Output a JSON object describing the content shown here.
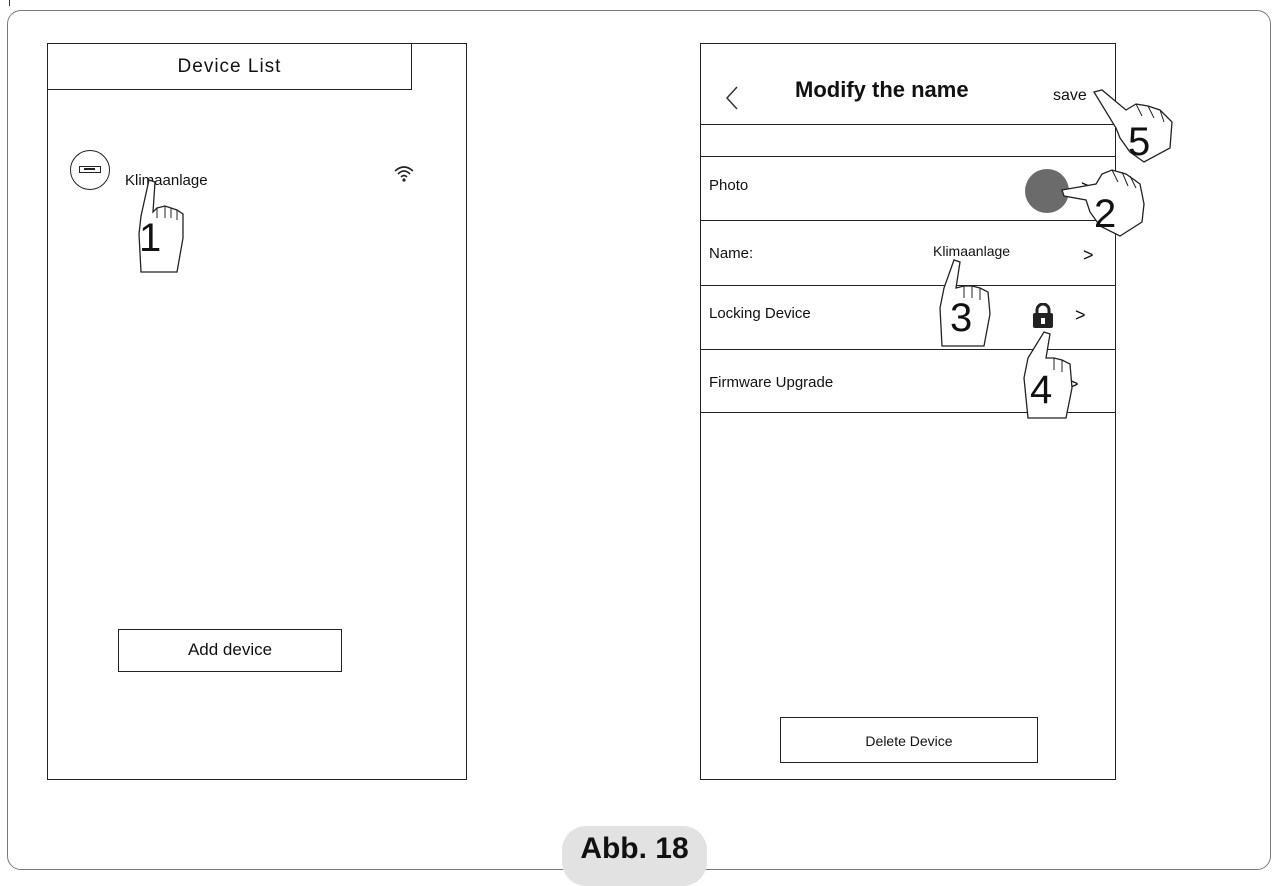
{
  "left_screen": {
    "title": "Device List",
    "device": {
      "name": "Klimaanlage",
      "icon": "air-conditioner-icon",
      "status_icon": "wifi-icon"
    },
    "add_button": "Add device"
  },
  "right_screen": {
    "header": {
      "back_icon": "chevron-left-icon",
      "title": "Modify the name",
      "save": "save"
    },
    "rows": [
      {
        "label": "Photo",
        "chevron": ">"
      },
      {
        "label": "Name:",
        "value": "Klimaanlage",
        "chevron": ">"
      },
      {
        "label": "Locking Device",
        "icon": "lock-icon",
        "chevron": ">"
      },
      {
        "label": "Firmware Upgrade",
        "chevron": ">"
      }
    ],
    "delete_button": "Delete Device"
  },
  "steps": [
    "1",
    "2",
    "3",
    "4",
    "5"
  ],
  "caption": "Abb. 18"
}
